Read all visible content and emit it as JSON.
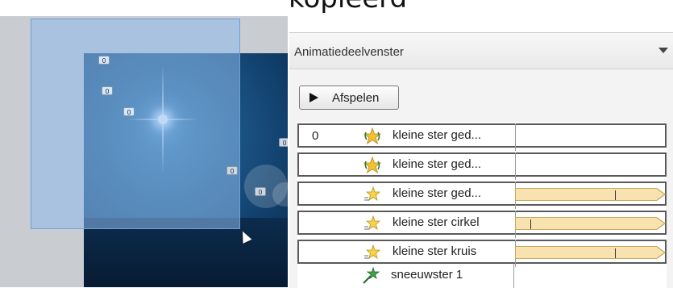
{
  "header_crop_text": "kleine ster gekopieerd",
  "slide_tags": [
    "0",
    "0",
    "0",
    "0",
    "0",
    "0"
  ],
  "pane": {
    "title": "Animatiedeelvenster",
    "play_label": "Afspelen"
  },
  "animations": [
    {
      "number": "0",
      "label": "kleine ster ged...",
      "icon": "spin-star-icon",
      "timeline_percent": null,
      "marker_percent": null
    },
    {
      "number": "",
      "label": "kleine ster ged...",
      "icon": "spin-star-icon",
      "timeline_percent": null,
      "marker_percent": null
    },
    {
      "number": "",
      "label": "kleine ster ged...",
      "icon": "motion-star-icon",
      "timeline_percent": 100,
      "marker_percent": 70
    },
    {
      "number": "",
      "label": "kleine ster cirkel",
      "icon": "motion-star-icon",
      "timeline_percent": 100,
      "marker_percent": 10
    },
    {
      "number": "",
      "label": "kleine ster kruis",
      "icon": "motion-star-icon",
      "timeline_percent": 100,
      "marker_percent": 70
    }
  ],
  "last_item": {
    "label": "sneeuwster 1",
    "icon": "entrance-star-icon"
  },
  "colors": {
    "selection": "#8cb9eb",
    "slide": "#1b5586",
    "timeline_bar": "#f8e3b0",
    "row_border": "#5a5a5a"
  }
}
